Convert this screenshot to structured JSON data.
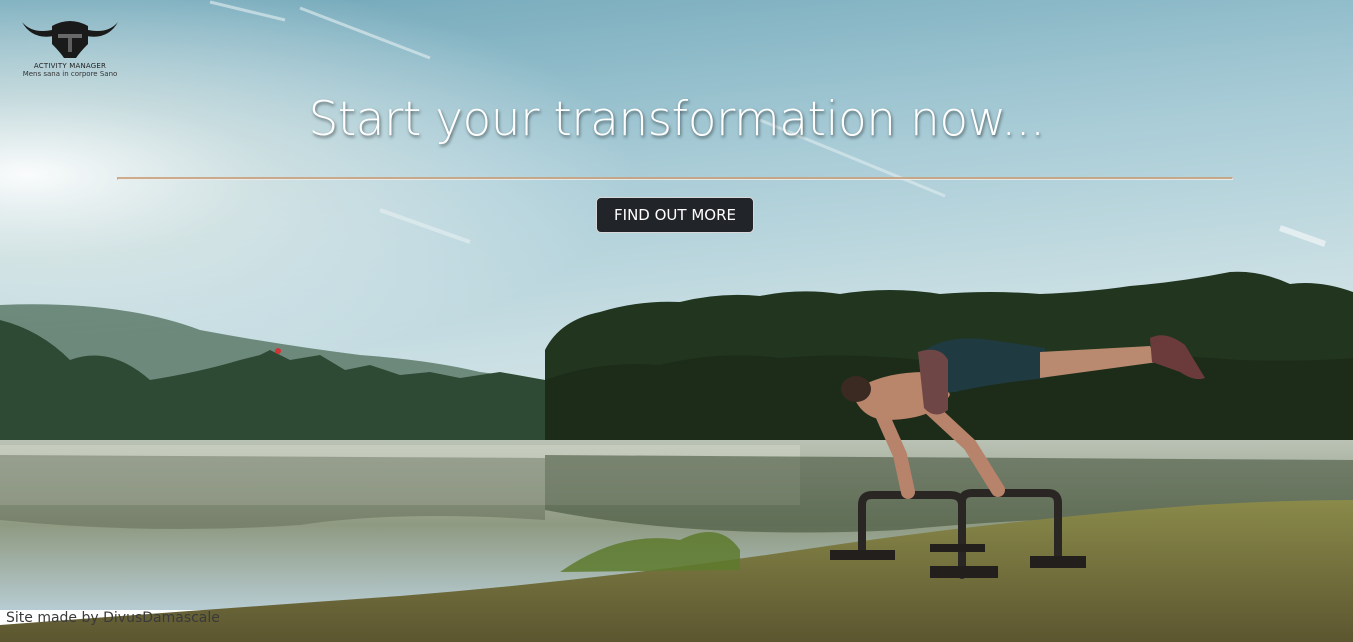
{
  "brand": {
    "name": "ACTIVITY MANAGER",
    "motto": "Mens sana in corpore Sano",
    "icon": "bull-helmet-icon"
  },
  "hero": {
    "headline": "Start your transformation now...",
    "cta_label": "FIND OUT MORE",
    "background": "man-doing-calisthenics-by-lake-photo"
  },
  "footer": {
    "credit": "Site made by DivusDamascale"
  },
  "colors": {
    "divider": "#c9a07a",
    "button_bg": "#212529",
    "headline": "#ffffff"
  }
}
